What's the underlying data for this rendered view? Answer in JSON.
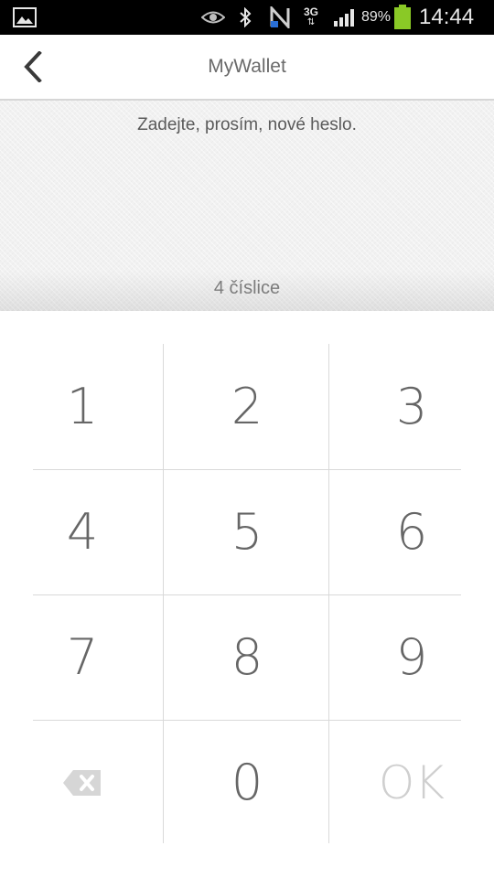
{
  "status_bar": {
    "battery_text": "89%",
    "time": "14:44",
    "network_text": "3G",
    "icons": [
      "gallery-icon",
      "eye-icon",
      "bluetooth-icon",
      "nfc-icon",
      "network-3g-icon",
      "signal-icon",
      "battery-icon"
    ]
  },
  "app_bar": {
    "title": "MyWallet",
    "back_icon": "back-chevron-icon"
  },
  "prompt": {
    "message": "Zadejte, prosím, nové heslo.",
    "digits_hint": "4 číslice"
  },
  "keypad": {
    "keys": [
      "1",
      "2",
      "3",
      "4",
      "5",
      "6",
      "7",
      "8",
      "9",
      "0"
    ],
    "delete_icon": "backspace-icon",
    "ok_label": "OK"
  },
  "colors": {
    "status_bar_bg": "#000000",
    "battery_fill": "#8ac926",
    "key_text": "#666666",
    "ok_disabled": "#cfcfcf"
  }
}
